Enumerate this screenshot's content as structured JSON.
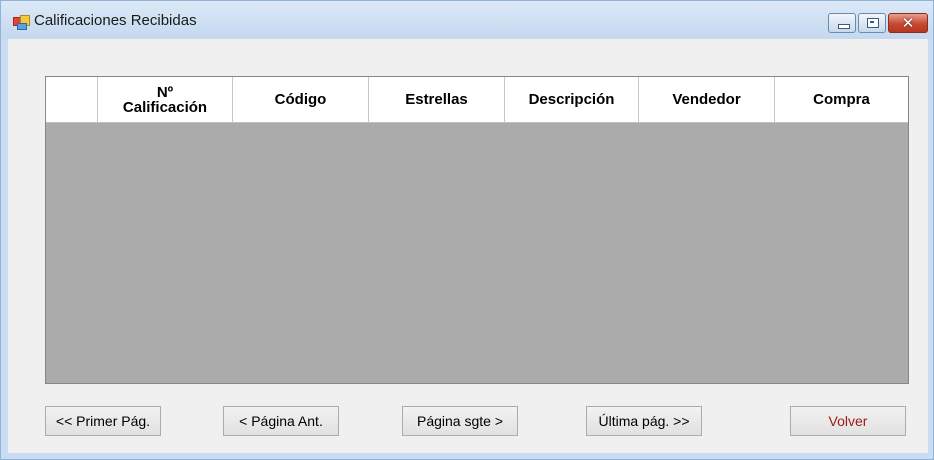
{
  "window": {
    "title": "Calificaciones Recibidas",
    "close_glyph": "✕"
  },
  "grid": {
    "columns": [
      {
        "line1": "Nº",
        "line2": "Calificación"
      },
      {
        "label": "Código"
      },
      {
        "label": "Estrellas"
      },
      {
        "label": "Descripción"
      },
      {
        "label": "Vendedor"
      },
      {
        "label": "Compra"
      }
    ],
    "rows": []
  },
  "buttons": {
    "first_page": "<< Primer Pág.",
    "prev_page": "< Página Ant.",
    "next_page": "Página sgte >",
    "last_page": "Última pág. >>",
    "back": "Volver"
  },
  "colors": {
    "grid_background": "#ababab",
    "back_button_text": "#a01919",
    "close_button": "#c44a33"
  }
}
